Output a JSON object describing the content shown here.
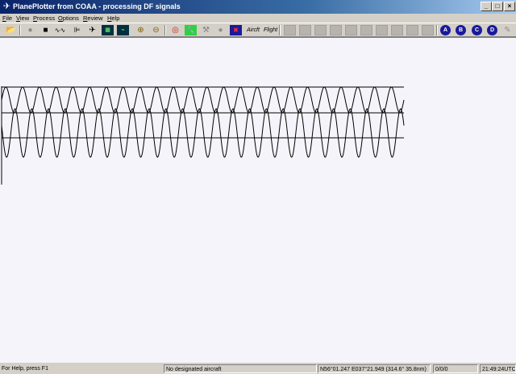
{
  "window": {
    "title": "PlanePlotter from COAA - processing DF signals",
    "app_icon": "✈",
    "controls": {
      "minimize": "_",
      "maximize": "□",
      "close": "×"
    }
  },
  "menu": [
    "File",
    "View",
    "Process",
    "Options",
    "Review",
    "Help"
  ],
  "toolbar": {
    "aircraft_label": "Aircft",
    "flight_label": "Flight",
    "circle_buttons": [
      "A",
      "B",
      "C",
      "D"
    ]
  },
  "status": {
    "help": "For Help, press F1",
    "aircraft": "No designated aircraft",
    "position": "N56°01.247 E037°21.949 (314.6°  35.8nm)",
    "counts": "0/0/0",
    "time": "21:49:24UTC"
  },
  "waveform": {
    "cycles": 24,
    "traces": 2,
    "colors": {
      "trace": "#000000",
      "axis": "#000000"
    }
  }
}
